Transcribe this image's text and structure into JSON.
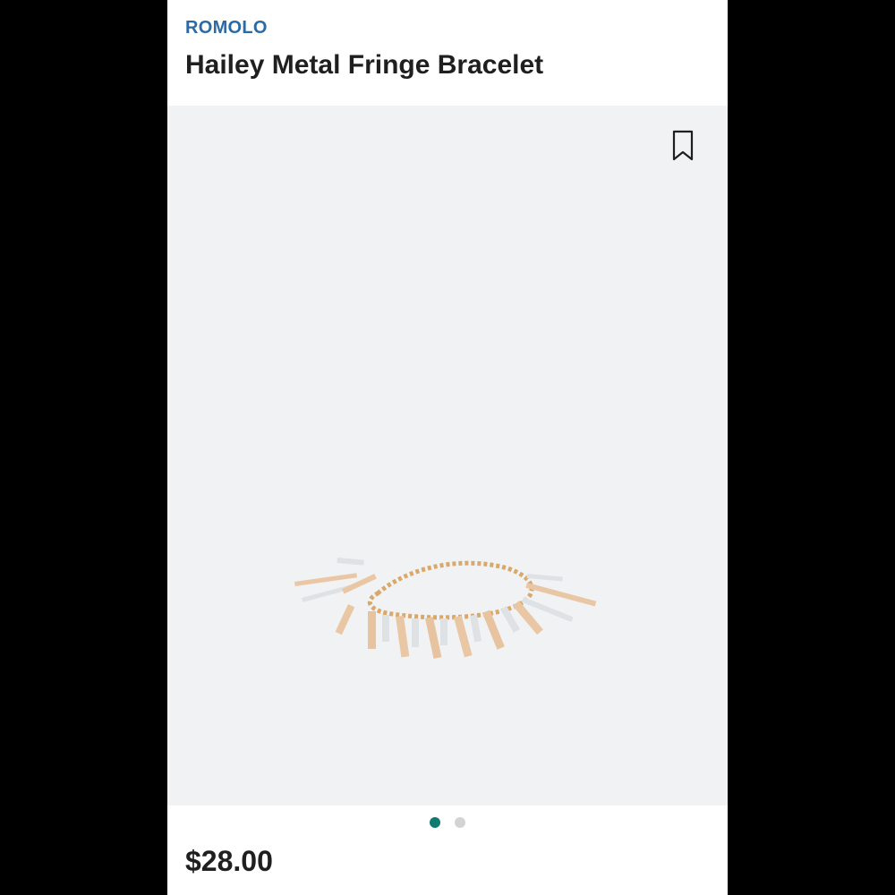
{
  "product": {
    "brand": "ROMOLO",
    "title": "Hailey Metal Fringe Bracelet",
    "price": "$28.00"
  },
  "gallery": {
    "image_count": 2,
    "active_index": 0,
    "bookmark_icon": "bookmark-icon",
    "background_color": "#f1f2f4"
  },
  "colors": {
    "brand": "#2b6aa3",
    "dot_active": "#0f7a72",
    "dot_inactive": "#d3d3d3"
  }
}
